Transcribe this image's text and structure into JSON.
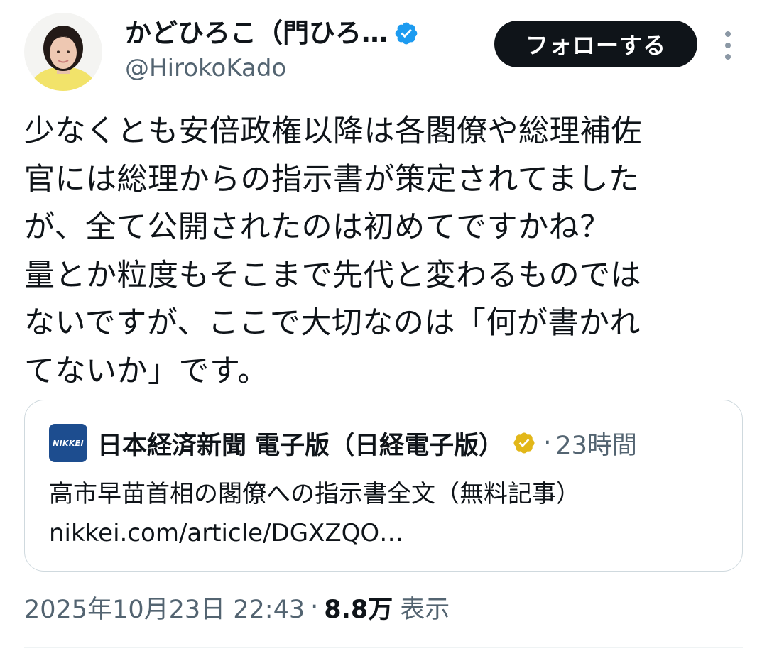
{
  "author": {
    "display_name": "かどひろこ（門ひろ…",
    "handle": "@HirokoKado",
    "verified_badge_icon": "verified-badge-icon",
    "verified_color": "#1d9bf0"
  },
  "actions": {
    "follow_label": "フォローする",
    "more_icon": "more-options-icon"
  },
  "tweet": {
    "text": "少なくとも安倍政権以降は各閣僚や総理補佐\n官には総理からの指示書が策定されてました\nが、全て公開されたのは初めてですかね？\n量とか粒度もそこまで先代と変わるものでは\nないですが、ここで大切なのは「何が書かれ\nてないか」です。"
  },
  "card": {
    "logo_text": "NIKKEI",
    "logo_color": "#1d4d8f",
    "source_name": "日本経済新聞 電子版（日経電子版）",
    "source_verified_color": "#e2b719",
    "dot": "·",
    "time_ago": "23時間",
    "headline": "高市早苗首相の閣僚への指示書全文（無料記事）",
    "url": "nikkei.com/article/DGXZQO…"
  },
  "meta": {
    "timestamp": "2025年10月23日 22:43",
    "separator": "·",
    "views_count": "8.8万",
    "views_label": "表示"
  },
  "colors": {
    "text_primary": "#0f1419",
    "text_secondary": "#536471",
    "border": "#cfd9de",
    "follow_button_bg": "#0f1419"
  }
}
